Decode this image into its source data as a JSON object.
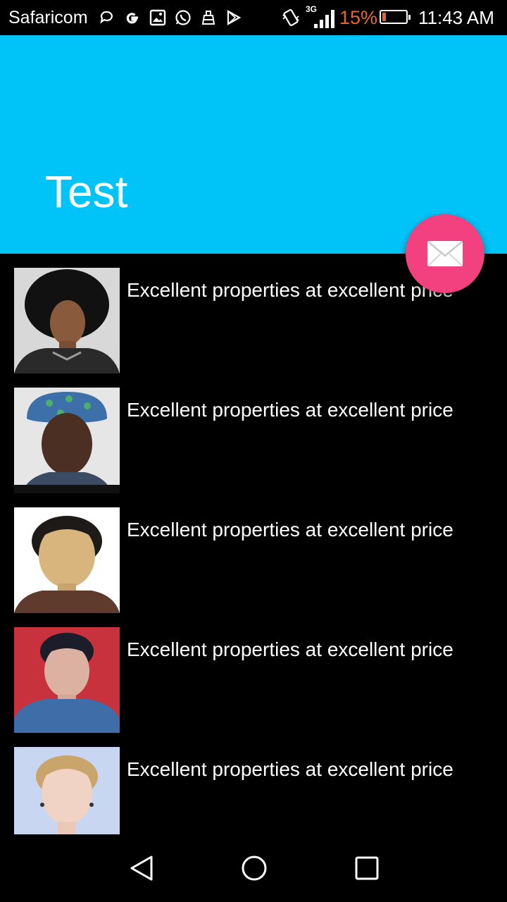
{
  "status_bar": {
    "carrier": "Safaricom",
    "network_type": "3G",
    "battery_percent": "15%",
    "battery_level": 0.15,
    "time": "11:43 AM",
    "icons_left": [
      "chat-bubble-icon",
      "google-icon",
      "image-icon",
      "whatsapp-icon",
      "cleaner-icon",
      "play-store-icon"
    ],
    "icons_right": [
      "vibrate-icon",
      "signal-icon"
    ],
    "battery_color": "#e8662a"
  },
  "app_bar": {
    "title": "Test",
    "color": "#00c4f8"
  },
  "fab": {
    "icon": "mail-icon",
    "color": "#f2417e"
  },
  "list": {
    "items": [
      {
        "text": "Excellent properties at excellent price",
        "photo": "portrait-photo"
      },
      {
        "text": "Excellent properties at excellent price",
        "photo": "portrait-photo"
      },
      {
        "text": "Excellent properties at excellent price",
        "photo": "portrait-photo"
      },
      {
        "text": "Excellent properties at excellent price",
        "photo": "portrait-photo"
      },
      {
        "text": "Excellent properties at excellent price",
        "photo": "portrait-photo"
      }
    ]
  },
  "nav_bar": {
    "buttons": [
      "back-icon",
      "home-icon",
      "recents-icon"
    ]
  }
}
